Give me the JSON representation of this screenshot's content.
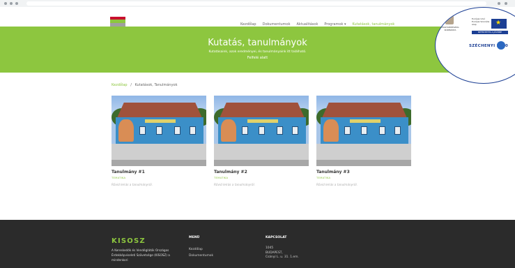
{
  "nav": {
    "items": [
      {
        "label": "Kezdőlap",
        "active": false
      },
      {
        "label": "Dokumentumok",
        "active": false
      },
      {
        "label": "Aktualitások",
        "active": false
      },
      {
        "label": "Programok ▾",
        "active": false
      },
      {
        "label": "Kutatások, tanulmányok",
        "active": true
      }
    ]
  },
  "hero": {
    "title": "Kutatás, tanulmányok",
    "subtitle": "Kutatásaink, azok eredményei, és tanulmányaink itt található.",
    "button": "Felfelé alatt"
  },
  "eu": {
    "crest_label": "MAGYARORSZÁG KORMÁNYA",
    "eu_text": "Európai Unió Európai Szociális Alap",
    "strip": "BEFEKTETÉS A JÖVŐBE",
    "szechenyi": "SZÉCHENYI 2020"
  },
  "breadcrumb": {
    "home": "Kezdőlap",
    "separator": "/",
    "current": "Kutatások, Tanulmányok"
  },
  "cards": [
    {
      "title": "Tanulmány #1",
      "category": "TEMATIKA",
      "desc": "Rövid leírás a tanulmányról."
    },
    {
      "title": "Tanulmány #2",
      "category": "TEMATIKA",
      "desc": "Rövid leírás a tanulmányról."
    },
    {
      "title": "Tanulmány #3",
      "category": "TEMATIKA",
      "desc": "Rövid leírás a tanulmányról."
    }
  ],
  "footer": {
    "brand": "KISOSZ",
    "about": "A Kereskedők és Vendéglátók Országos Érdekképviseleti Szövetsége (KISOSZ) a mindenkori",
    "menu_heading": "MENÜ",
    "menu_items": [
      "Kezdőlap",
      "Dokumentumok"
    ],
    "contact_heading": "KAPCSOLAT",
    "contact_lines": [
      "1045",
      "BUDAPEST,",
      "Csányi L. u. 31. 1.em."
    ]
  },
  "colors": {
    "accent": "#8dc63f",
    "footer_bg": "#2b2b2b",
    "eu_blue": "#1c3f94"
  }
}
